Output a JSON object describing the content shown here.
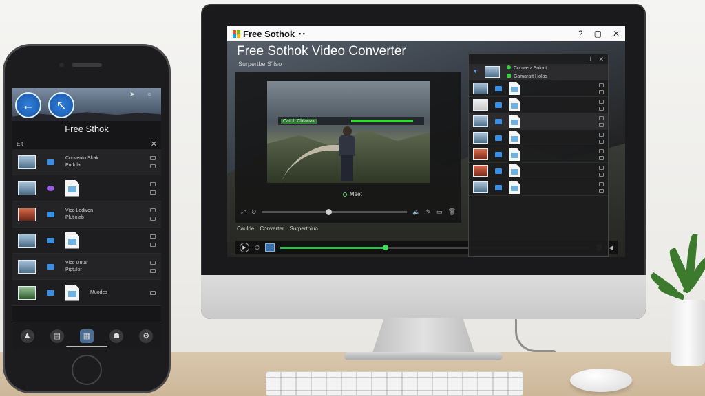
{
  "desktop_app": {
    "window_title": "Free Sothok",
    "window_title_dots": "• •",
    "window_controls": {
      "help": "?",
      "restore": "▢",
      "close": "✕"
    },
    "app_heading": "Free Sothok Video Converter",
    "app_subheading": "Surpertbe S'ilso",
    "preview": {
      "overlay_label": "Catch Chfauak",
      "status_label": "Meet"
    },
    "tabs": [
      "Caulde",
      "Converter",
      "Surperthiuo"
    ],
    "side_panel": {
      "rows": [
        {
          "thumb": "photo",
          "line1": "Conwelz Soluct",
          "line2": "Gamaratt Holbs",
          "selected": true
        },
        {
          "thumb": "photo"
        },
        {
          "thumb": "white"
        },
        {
          "thumb": "photo",
          "selected": true
        },
        {
          "thumb": "photo"
        },
        {
          "thumb": "red"
        },
        {
          "thumb": "red"
        },
        {
          "thumb": "photo"
        }
      ]
    },
    "timeline": {
      "progress": 0.34
    }
  },
  "mobile_app": {
    "title": "Free Sthok",
    "header_left": "Eit",
    "rows": [
      {
        "thumb": "photo",
        "line1": "Convento Slrak",
        "line2": "Pudolar",
        "alt": true
      },
      {
        "thumb": "photo",
        "folder": "purple"
      },
      {
        "thumb": "red",
        "line1": "Vico Lodivon",
        "line2": "Plutiolab",
        "alt": true
      },
      {
        "thumb": "photo"
      },
      {
        "thumb": "photo",
        "line1": "Vico Untar",
        "line2": "Piptulor",
        "alt": true
      },
      {
        "thumb": "green",
        "line1": "Muodes"
      }
    ],
    "dock": [
      {
        "icon": "profile-icon",
        "glyph": "♟"
      },
      {
        "icon": "archive-icon",
        "glyph": "▤"
      },
      {
        "icon": "gallery-icon",
        "glyph": "▦",
        "selected": true
      },
      {
        "icon": "chef-icon",
        "glyph": "☗"
      },
      {
        "icon": "settings-icon",
        "glyph": "⚙"
      }
    ]
  },
  "colors": {
    "accent": "#3bd13b",
    "folder": "#3c8fe0",
    "panel": "#1c1c1e"
  }
}
